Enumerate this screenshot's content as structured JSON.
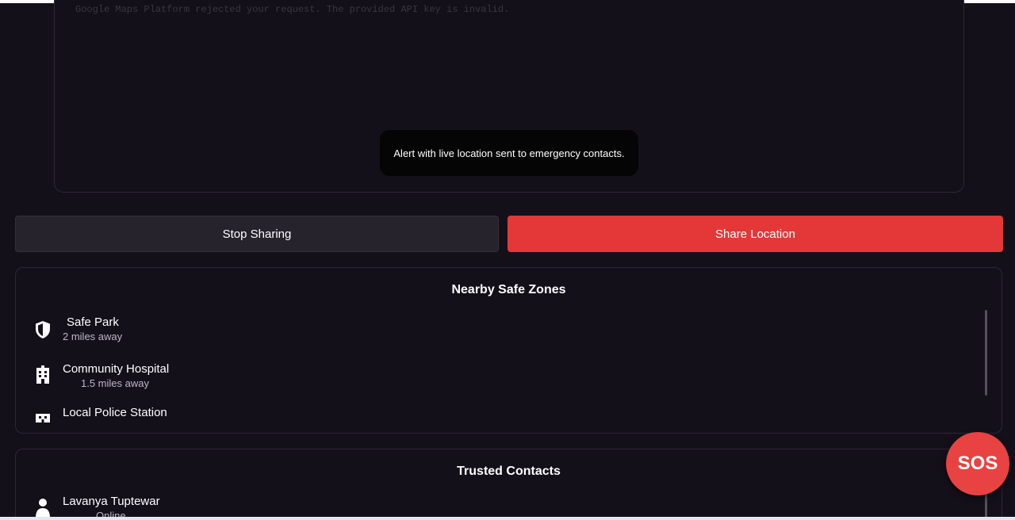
{
  "map": {
    "error_text": "Google Maps Platform rejected your request. The provided API key is invalid."
  },
  "toast": {
    "message": "Alert with live location sent to emergency contacts."
  },
  "actions": {
    "stop_label": "Stop Sharing",
    "share_label": "Share Location"
  },
  "safe_zones": {
    "title": "Nearby Safe Zones",
    "items": [
      {
        "name": "Safe Park",
        "distance": "2 miles away",
        "icon": "shield-icon"
      },
      {
        "name": "Community Hospital",
        "distance": "1.5 miles away",
        "icon": "hospital-icon"
      },
      {
        "name": "Local Police Station",
        "distance": "",
        "icon": "police-station-icon"
      }
    ]
  },
  "contacts": {
    "title": "Trusted Contacts",
    "items": [
      {
        "name": "Lavanya Tuptewar",
        "status": "Online",
        "icon": "person-icon"
      }
    ]
  },
  "sos": {
    "label": "SOS"
  },
  "colors": {
    "background": "#14101a",
    "accent_red": "#e43838",
    "secondary_button": "#26232d"
  }
}
